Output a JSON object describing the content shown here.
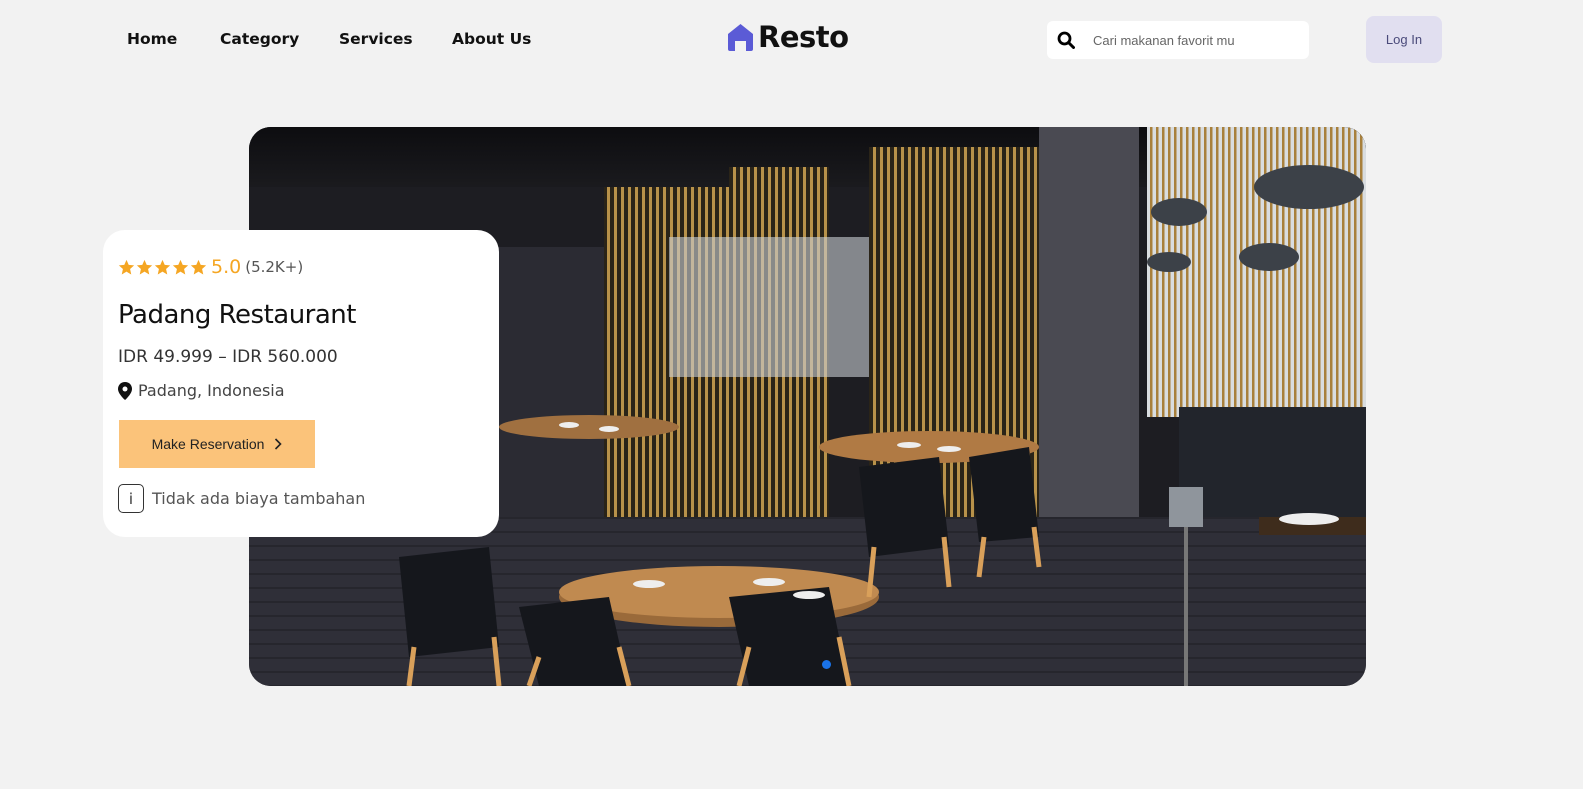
{
  "nav": {
    "links": [
      "Home",
      "Category",
      "Services",
      "About Us"
    ]
  },
  "logo": {
    "text": "Resto",
    "icon": "house-icon"
  },
  "search": {
    "placeholder": "Cari makanan favorit mu",
    "icon": "search-icon"
  },
  "login": {
    "label": "Log In"
  },
  "hero": {
    "image": "restaurant-interior-photo"
  },
  "card": {
    "rating": "5.0",
    "stars": 5,
    "rating_count": "(5.2K+)",
    "title": "Padang Restaurant",
    "price": "IDR 49.999 – IDR 560.000",
    "location": "Padang, Indonesia",
    "reserve_label": "Make Reservation",
    "info_glyph": "i",
    "info_text": "Tidak ada biaya tambahan"
  },
  "colors": {
    "accent": "#5b5bd6",
    "star": "#f5a623",
    "button": "#fbc37a",
    "login_bg": "#e1dff0",
    "slider_dot": "#1a73e8"
  }
}
